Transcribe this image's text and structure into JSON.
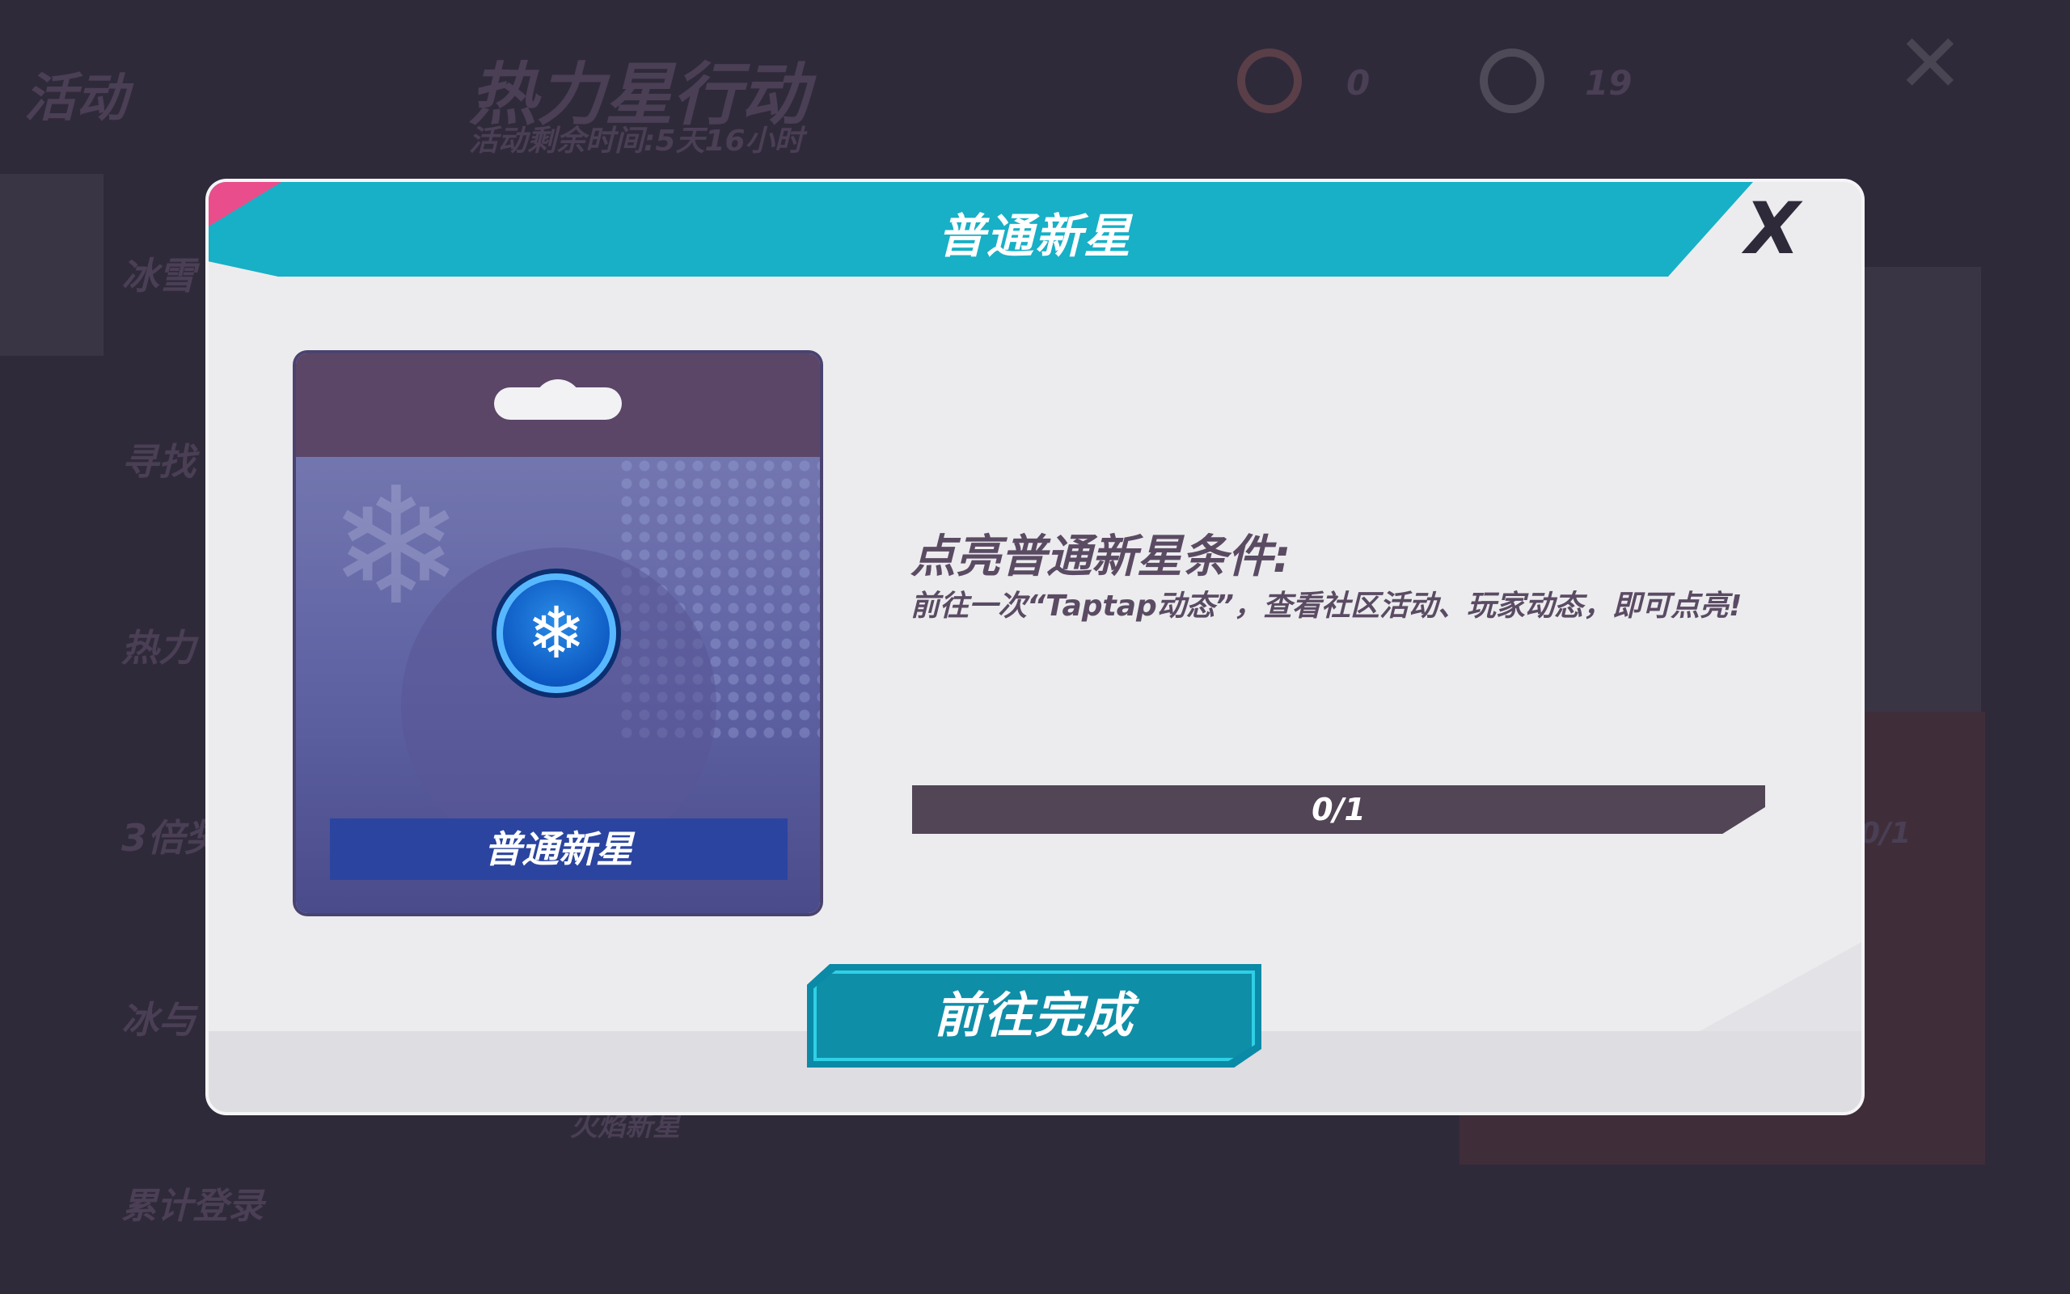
{
  "background": {
    "app_section_title": "活动",
    "event_title": "热力星行动",
    "event_time_remaining": "活动剩余时间:5天16小时",
    "currency_1_count": "0",
    "currency_2_count": "19",
    "sidebar_items": [
      "冰雪",
      "寻找",
      "热力",
      "3倍奖",
      "冰与",
      "累计登录"
    ],
    "under_modal_label": "火焰新星",
    "partial_progress": "0/1"
  },
  "dialog": {
    "title": "普通新星",
    "close_label": "X",
    "card": {
      "badge_icon": "snowflake-icon",
      "badge_glyph": "❄",
      "name": "普通新星"
    },
    "condition_title": "点亮普通新星条件:",
    "condition_description": "前往一次“Taptap动态”，查看社区活动、玩家动态，即可点亮!",
    "progress": {
      "current": 0,
      "total": 1,
      "label": "0/1"
    },
    "action_button_label": "前往完成"
  },
  "colors": {
    "header": "#17b0c6",
    "accent_pink": "#ea4d8b",
    "button": "#0f8ea8",
    "progress_track": "#514556",
    "card_label": "#2a44a0"
  }
}
